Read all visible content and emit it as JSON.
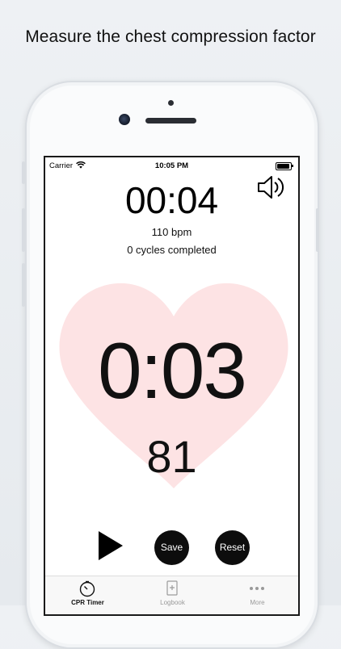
{
  "headline": "Measure the chest compression factor",
  "status_bar": {
    "carrier": "Carrier",
    "time": "10:05 PM"
  },
  "timer": {
    "elapsed": "00:04",
    "bpm": "110 bpm",
    "cycles": "0 cycles completed",
    "countdown": "0:03",
    "compression_count": "81"
  },
  "controls": {
    "save_label": "Save",
    "reset_label": "Reset"
  },
  "tabs": [
    {
      "label": "CPR Timer",
      "icon": "stopwatch-icon",
      "active": true
    },
    {
      "label": "Logbook",
      "icon": "logbook-icon",
      "active": false
    },
    {
      "label": "More",
      "icon": "more-icon",
      "active": false
    }
  ],
  "colors": {
    "heart": "#fde3e4",
    "button": "#0d0d0d",
    "tab_inactive": "#9a9a9a"
  }
}
